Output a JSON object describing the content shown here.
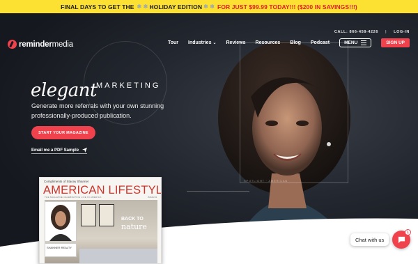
{
  "banner": {
    "part1": "FINAL DAYS TO GET THE",
    "snow1": "❄ ❄",
    "holiday": "HOLIDAY EDITION",
    "snow2": "❄ ❄",
    "offer": "FOR JUST $99.99 TODAY!!! ($200 IN SAVINGS!!!)"
  },
  "topbar": {
    "call": "CALL: 866-458-4226",
    "separator": "|",
    "login": "LOG-IN"
  },
  "logo": {
    "bold": "reminder",
    "rest": "media"
  },
  "nav": {
    "items": [
      "Tour",
      "Industries",
      "Reviews",
      "Resources",
      "Blog",
      "Podcast"
    ],
    "industries_caret": "⌄",
    "menu": "MENU",
    "signup": "SIGN UP"
  },
  "hero": {
    "script": "elegant",
    "marketing": "MARKETING",
    "subtitle": "Generate more referrals with your own stunning professionally-produced publication.",
    "cta": "START YOUR MAGAZINE",
    "pdf": "Email me a PDF Sample",
    "caption": "SPOTLIGHT · AMERICAN"
  },
  "magazine": {
    "compliments": "Compliments of Stacey Shanner",
    "title": "AMERICAN LIFESTYLE",
    "tagline": "THE MAGAZINE CELEBRATING LIFE IN AMERICA",
    "issue": "ISSUE 84",
    "back": "BACK TO",
    "nature": "nature",
    "realty": "SHANNER REALTY"
  },
  "chat": {
    "label": "Chat with us",
    "badge": "1"
  },
  "colors": {
    "accent": "#f0424d",
    "banner": "#fde132"
  }
}
